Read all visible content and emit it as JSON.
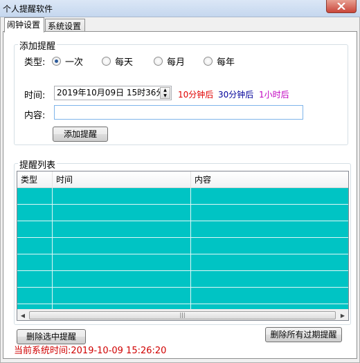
{
  "window": {
    "title": "个人提醒软件"
  },
  "tabs": [
    {
      "label": "闹钟设置"
    },
    {
      "label": "系统设置"
    }
  ],
  "add_group": {
    "title": "添加提醒",
    "type_label": "类型:",
    "types": [
      {
        "label": "一次",
        "checked": true
      },
      {
        "label": "每天",
        "checked": false
      },
      {
        "label": "每月",
        "checked": false
      },
      {
        "label": "每年",
        "checked": false
      }
    ],
    "time_label": "时间:",
    "datetime_value": "2019年10月09日  15时36分",
    "quick": [
      {
        "label": "10分钟后",
        "color": "#e00000"
      },
      {
        "label": "30分钟后",
        "color": "#000099"
      },
      {
        "label": "1小时后",
        "color": "#c000c0"
      }
    ],
    "content_label": "内容:",
    "content_value": "",
    "add_button": "添加提醒"
  },
  "list_group": {
    "title": "提醒列表",
    "columns": [
      "类型",
      "时间",
      "内容"
    ],
    "rows": [
      [
        "",
        "",
        ""
      ],
      [
        "",
        "",
        ""
      ],
      [
        "",
        "",
        ""
      ],
      [
        "",
        "",
        ""
      ],
      [
        "",
        "",
        ""
      ],
      [
        "",
        "",
        ""
      ],
      [
        "",
        "",
        ""
      ],
      [
        "",
        "",
        ""
      ]
    ],
    "row_color": "#00c4c4"
  },
  "buttons": {
    "delete_selected": "删除选中提醒",
    "delete_expired": "删除所有过期提醒"
  },
  "status": {
    "current_time_text": "当前系统时间:2019-10-09  15:26:20",
    "color": "#d00000"
  }
}
